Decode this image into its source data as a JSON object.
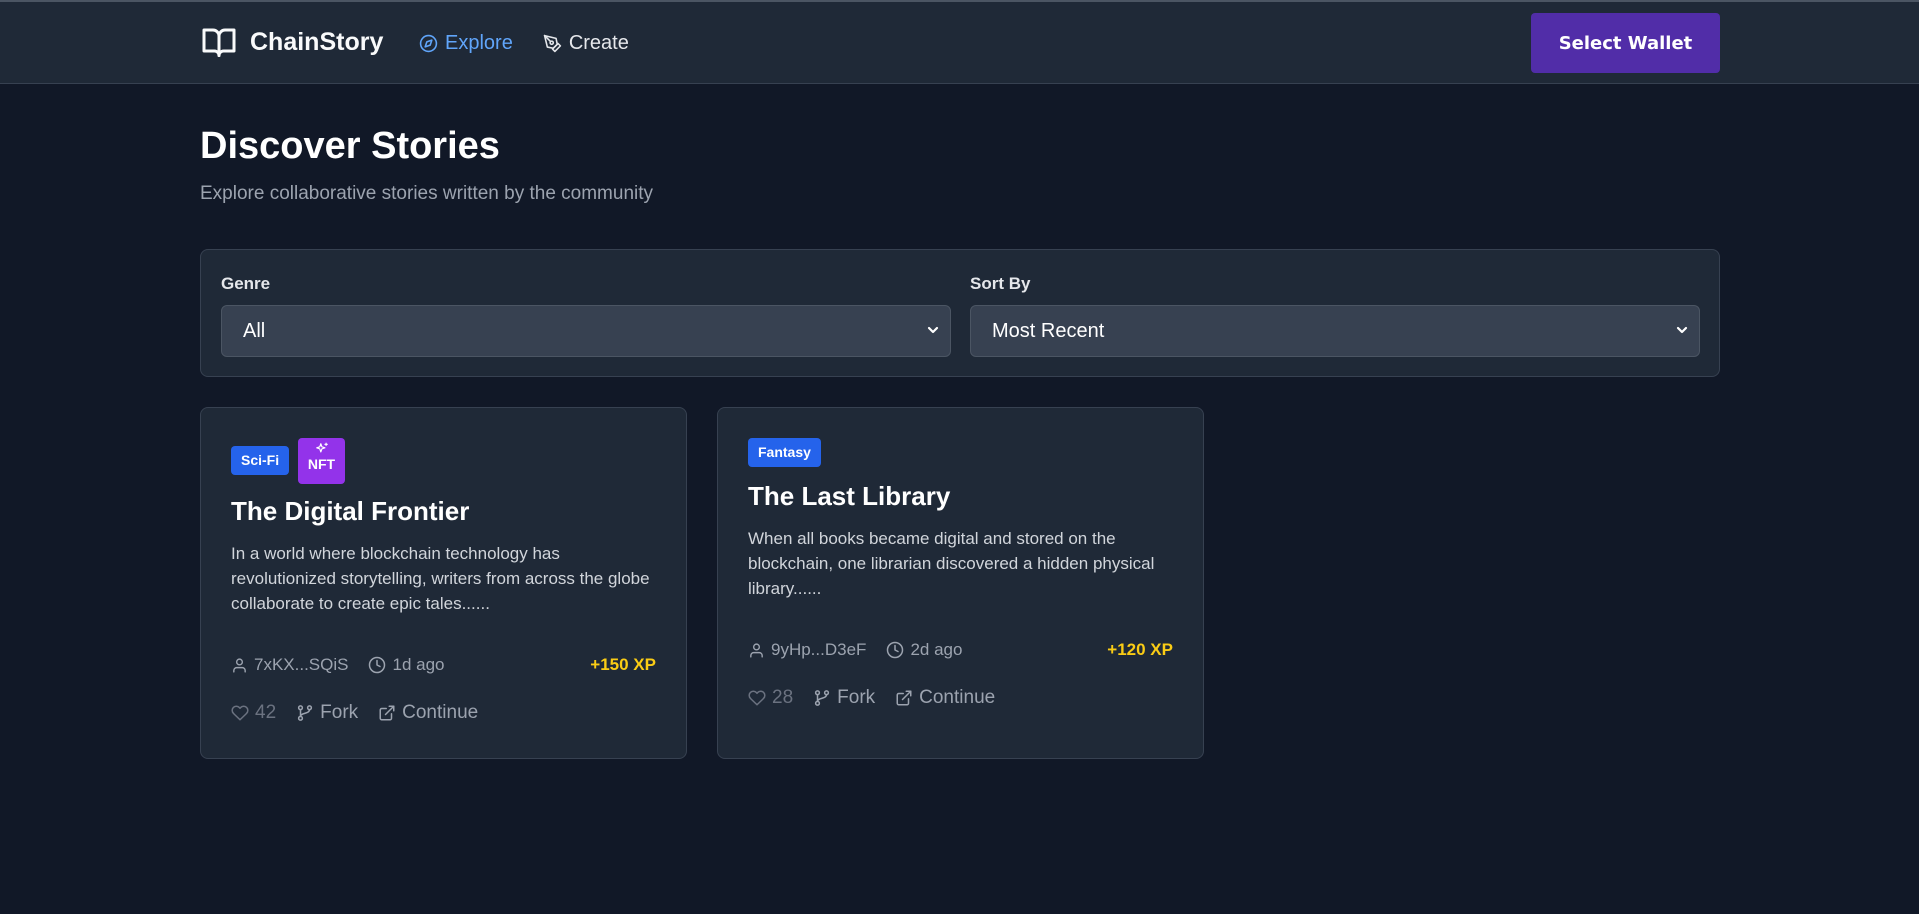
{
  "header": {
    "brand": "ChainStory",
    "nav": [
      {
        "label": "Explore",
        "icon": "compass-icon",
        "active": true
      },
      {
        "label": "Create",
        "icon": "pen-icon",
        "active": false
      }
    ],
    "wallet_button": "Select Wallet"
  },
  "page": {
    "title": "Discover Stories",
    "subtitle": "Explore collaborative stories written by the community"
  },
  "filters": {
    "genre": {
      "label": "Genre",
      "value": "All"
    },
    "sort": {
      "label": "Sort By",
      "value": "Most Recent"
    }
  },
  "stories": [
    {
      "genre": "Sci-Fi",
      "nft_badge": "NFT",
      "title": "The Digital Frontier",
      "description": "In a world where blockchain technology has revolutionized storytelling, writers from across the globe collaborate to create epic tales......",
      "author": "7xKX...SQiS",
      "time": "1d ago",
      "xp": "+150 XP",
      "likes": "42",
      "fork_label": "Fork",
      "continue_label": "Continue"
    },
    {
      "genre": "Fantasy",
      "title": "The Last Library",
      "description": "When all books became digital and stored on the blockchain, one librarian discovered a hidden physical library......",
      "author": "9yHp...D3eF",
      "time": "2d ago",
      "xp": "+120 XP",
      "likes": "28",
      "fork_label": "Fork",
      "continue_label": "Continue"
    }
  ],
  "colors": {
    "background": "#111827",
    "surface": "#1f2937",
    "accent_blue": "#60a5fa",
    "wallet_purple": "#512da8",
    "genre_badge": "#2563eb",
    "nft_badge": "#9333ea",
    "xp_yellow": "#facc15"
  }
}
